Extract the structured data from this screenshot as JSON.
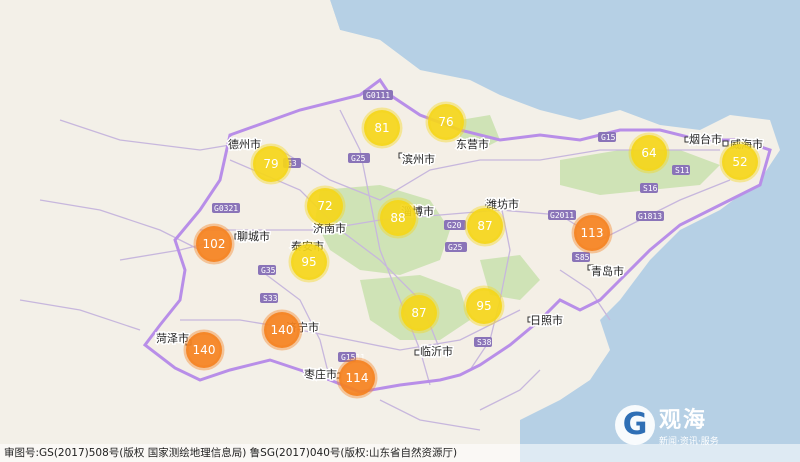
{
  "cities": [
    {
      "id": "dezhou",
      "name": "德州市"
    },
    {
      "id": "binzhou",
      "name": "滨州市"
    },
    {
      "id": "dongying",
      "name": "东营市"
    },
    {
      "id": "yantai",
      "name": "烟台市"
    },
    {
      "id": "weihai",
      "name": "威海市"
    },
    {
      "id": "jinan",
      "name": "济南市"
    },
    {
      "id": "liaocheng",
      "name": "聊城市"
    },
    {
      "id": "zibo",
      "name": "淄博市"
    },
    {
      "id": "weifang",
      "name": "潍坊市"
    },
    {
      "id": "taian",
      "name": "泰安市"
    },
    {
      "id": "qingdao",
      "name": "青岛市"
    },
    {
      "id": "rizhao",
      "name": "日照市"
    },
    {
      "id": "linyi",
      "name": "临沂市"
    },
    {
      "id": "heze",
      "name": "菏泽市"
    },
    {
      "id": "jining",
      "name": "济宁市"
    },
    {
      "id": "zaozhuang",
      "name": "枣庄市"
    }
  ],
  "markers": [
    {
      "id": "m-dezhou",
      "value": 79,
      "level": "medium"
    },
    {
      "id": "m-binzhou",
      "value": 81,
      "level": "medium"
    },
    {
      "id": "m-dongying",
      "value": 76,
      "level": "medium"
    },
    {
      "id": "m-yantai",
      "value": 64,
      "level": "medium"
    },
    {
      "id": "m-weihai",
      "value": 52,
      "level": "medium"
    },
    {
      "id": "m-jinan",
      "value": 72,
      "level": "medium"
    },
    {
      "id": "m-zibo",
      "value": 88,
      "level": "medium"
    },
    {
      "id": "m-weifang",
      "value": 87,
      "level": "medium"
    },
    {
      "id": "m-liaocheng",
      "value": 102,
      "level": "high"
    },
    {
      "id": "m-qingdao",
      "value": 113,
      "level": "high"
    },
    {
      "id": "m-taian",
      "value": 95,
      "level": "medium"
    },
    {
      "id": "m-linyi",
      "value": 87,
      "level": "medium"
    },
    {
      "id": "m-rizhao",
      "value": 95,
      "level": "medium"
    },
    {
      "id": "m-jining",
      "value": 140,
      "level": "high"
    },
    {
      "id": "m-heze",
      "value": 140,
      "level": "high"
    },
    {
      "id": "m-zaozhuang",
      "value": 114,
      "level": "high"
    }
  ],
  "roads": [
    "G0111",
    "G25",
    "G3",
    "G0321",
    "G20",
    "G2011",
    "G15",
    "G1813",
    "S16",
    "S11",
    "S85",
    "G35",
    "S33",
    "G25",
    "G1511",
    "S38"
  ],
  "colors": {
    "land": "#f3f0e8",
    "sea": "#b6d0e5",
    "green": "#cfe3b6",
    "boundary": "#b88ee8",
    "road": "#c7b7dd",
    "marker_medium": "#f5d61a",
    "marker_high": "#f58220"
  },
  "footer": {
    "text": "审图号:GS(2017)508号(版权 国家测绘地理信息局) 鲁SG(2017)040号(版权:山东省自然资源厅)"
  },
  "logo": {
    "mark": "G",
    "name": "观海",
    "slogan": "新闻·资讯·服务"
  }
}
